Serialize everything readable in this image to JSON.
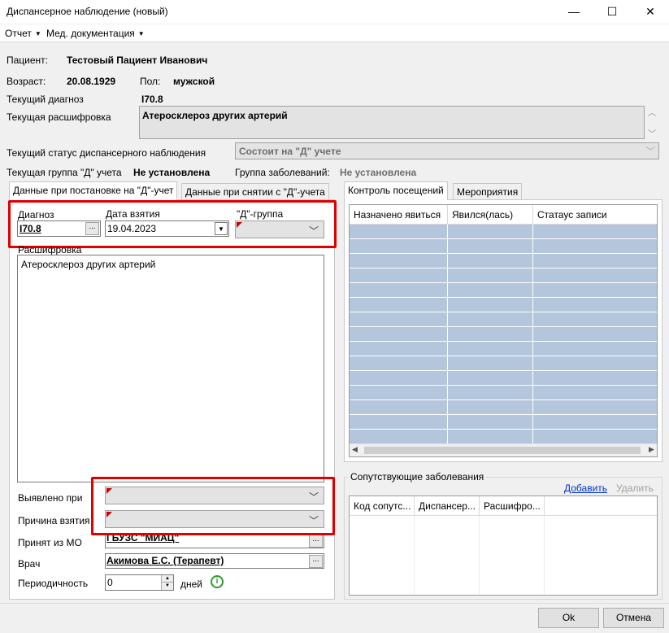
{
  "window": {
    "title": "Диспансерное наблюдение (новый)",
    "minimize": "—",
    "maximize": "☐",
    "close": "✕"
  },
  "menu": {
    "report": "Отчет",
    "med_docs": "Мед. документация"
  },
  "patient": {
    "label": "Пациент:",
    "name": "Тестовый Пациент Иванович",
    "age_label": "Возраст:",
    "age": "20.08.1929",
    "sex_label": "Пол:",
    "sex": "мужской",
    "diag_label": "Текущий диагноз",
    "diag": "I70.8",
    "decoding_label": "Текущая расшифровка",
    "decoding": "Атеросклероз других артерий",
    "status_label": "Текущий статус диспансерного наблюдения",
    "status": "Состоит на \"Д\" учете",
    "group_label": "Текущая группа \"Д\" учета",
    "group": "Не установлена",
    "disease_group_label": "Группа заболеваний:",
    "disease_group": "Не установлена"
  },
  "left_tabs": [
    "Данные при постановке на \"Д\"-учет",
    "Данные при снятии с \"Д\"-учета"
  ],
  "form": {
    "diagnosis_label": "Диагноз",
    "diagnosis_value": "I70.8",
    "date_label": "Дата взятия",
    "date_value": "19.04.2023",
    "dgroup_label": "\"Д\"-группа",
    "dgroup_value": "",
    "decoding_label": "Расшифровка",
    "decoding_value": "Атеросклероз других артерий",
    "detected_label": "Выявлено при",
    "detected_value": "",
    "reason_label": "Причина взятия",
    "reason_value": "",
    "mo_label": "Принят из МО",
    "mo_value": "ГБУЗС \"МИАЦ\"",
    "doctor_label": "Врач",
    "doctor_value": "Акимова Е.С. (Терапевт)",
    "period_label": "Периодичность",
    "period_value": "0",
    "period_unit": "дней",
    "dots": "..."
  },
  "right_tabs": [
    "Контроль посещений",
    "Мероприятия"
  ],
  "visits_grid": {
    "columns": [
      "Назначено явиться",
      "Явился(лась)",
      "Статаус записи"
    ],
    "empty_rows": 15
  },
  "comorbid": {
    "title": "Сопутствующие заболевания",
    "add": "Добавить",
    "remove": "Удалить",
    "columns": [
      "Код сопутс...",
      "Диспансер...",
      "Расшифро..."
    ]
  },
  "buttons": {
    "ok": "Ok",
    "cancel": "Отмена"
  },
  "colors": {
    "highlight_box": "#e00000",
    "grid_rows": "#b4c6dc",
    "info_icon": "#2e9a2e"
  }
}
